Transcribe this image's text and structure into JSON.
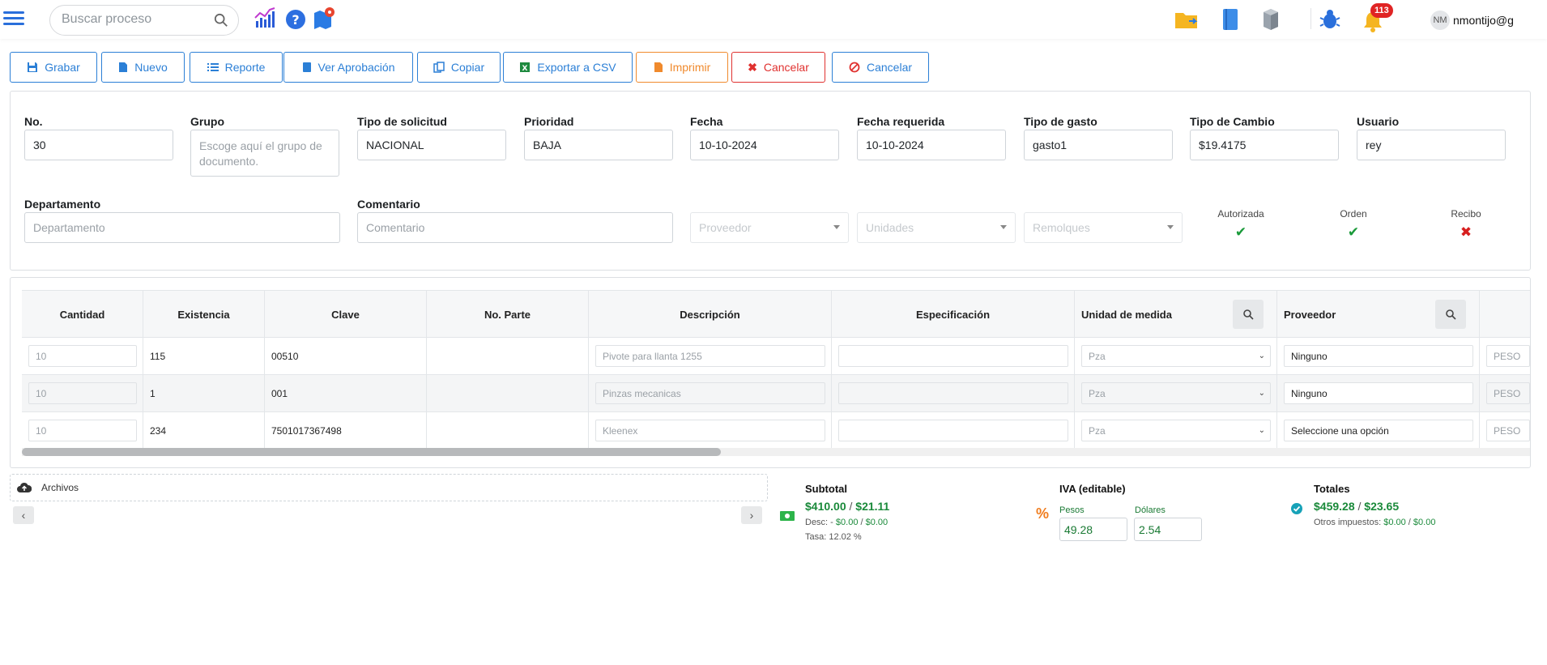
{
  "header": {
    "search_placeholder": "Buscar proceso",
    "notification_count": "113",
    "avatar_initials": "NM",
    "username": "nmontijo@g"
  },
  "toolbar": {
    "buttons": [
      {
        "label": "Grabar",
        "icon": "save-icon"
      },
      {
        "label": "Nuevo",
        "icon": "file-icon"
      },
      {
        "label": "Reporte",
        "icon": "list-icon"
      },
      {
        "label": "Ver Aprobación",
        "icon": "book-icon"
      },
      {
        "label": "Copiar",
        "icon": "copy-icon"
      },
      {
        "label": "Exportar a CSV",
        "icon": "excel-icon"
      },
      {
        "label": "Imprimir",
        "icon": "pdf-icon"
      },
      {
        "label": "Cancelar",
        "icon": "x-icon"
      },
      {
        "label": "Cancelar",
        "icon": "ban-icon"
      }
    ]
  },
  "form": {
    "no": {
      "label": "No.",
      "value": "30"
    },
    "grupo": {
      "label": "Grupo",
      "placeholder": "Escoge aquí el grupo de documento."
    },
    "tipo_solicitud": {
      "label": "Tipo de solicitud",
      "value": "NACIONAL"
    },
    "prioridad": {
      "label": "Prioridad",
      "value": "BAJA"
    },
    "fecha": {
      "label": "Fecha",
      "value": "10-10-2024"
    },
    "fecha_requerida": {
      "label": "Fecha requerida",
      "value": "10-10-2024"
    },
    "tipo_gasto": {
      "label": "Tipo de gasto",
      "value": "gasto1"
    },
    "tipo_cambio": {
      "label": "Tipo de Cambio",
      "value": "$19.4175"
    },
    "usuario": {
      "label": "Usuario",
      "value": "rey"
    },
    "departamento": {
      "label": "Departamento",
      "placeholder": "Departamento"
    },
    "comentario": {
      "label": "Comentario",
      "placeholder": "Comentario"
    },
    "proveedor_select": "Proveedor",
    "unidades_select": "Unidades",
    "remolques_select": "Remolques",
    "status": {
      "autorizada": {
        "label": "Autorizada",
        "mark": "✔"
      },
      "orden": {
        "label": "Orden",
        "mark": "✔"
      },
      "recibo": {
        "label": "Recibo",
        "mark": "✖"
      }
    }
  },
  "table": {
    "headers": [
      "Cantidad",
      "Existencia",
      "Clave",
      "No. Parte",
      "Descripción",
      "Especificación",
      "Unidad de medida",
      "Proveedor"
    ],
    "rows": [
      {
        "cantidad": "10",
        "existencia": "115",
        "clave": "00510",
        "no_parte": "",
        "descripcion": "Pivote para llanta 1255",
        "especificacion": "",
        "unidad": "Pza",
        "proveedor": "Ninguno",
        "moneda": "PESO"
      },
      {
        "cantidad": "10",
        "existencia": "1",
        "clave": "001",
        "no_parte": "",
        "descripcion": "Pinzas mecanicas",
        "especificacion": "",
        "unidad": "Pza",
        "proveedor": "Ninguno",
        "moneda": "PESO"
      },
      {
        "cantidad": "10",
        "existencia": "234",
        "clave": "7501017367498",
        "no_parte": "",
        "descripcion": "Kleenex",
        "especificacion": "",
        "unidad": "Pza",
        "proveedor": "Seleccione una opción",
        "moneda": "PESO"
      }
    ]
  },
  "archivos": {
    "label": "Archivos"
  },
  "summary": {
    "subtotal": {
      "title": "Subtotal",
      "pesos": "$410.00",
      "dolares": "$21.11",
      "desc_label": "Desc: -",
      "desc_pesos": "$0.00",
      "desc_dolares": "$0.00",
      "tasa": "Tasa: 12.02 %"
    },
    "iva": {
      "title": "IVA (editable)",
      "pesos_label": "Pesos",
      "dolares_label": "Dólares",
      "pesos": "49.28",
      "dolares": "2.54"
    },
    "totales": {
      "title": "Totales",
      "pesos": "$459.28",
      "dolares": "$23.65",
      "otros_label": "Otros impuestos:",
      "otros_pesos": "$0.00",
      "otros_dolares": "$0.00"
    }
  }
}
